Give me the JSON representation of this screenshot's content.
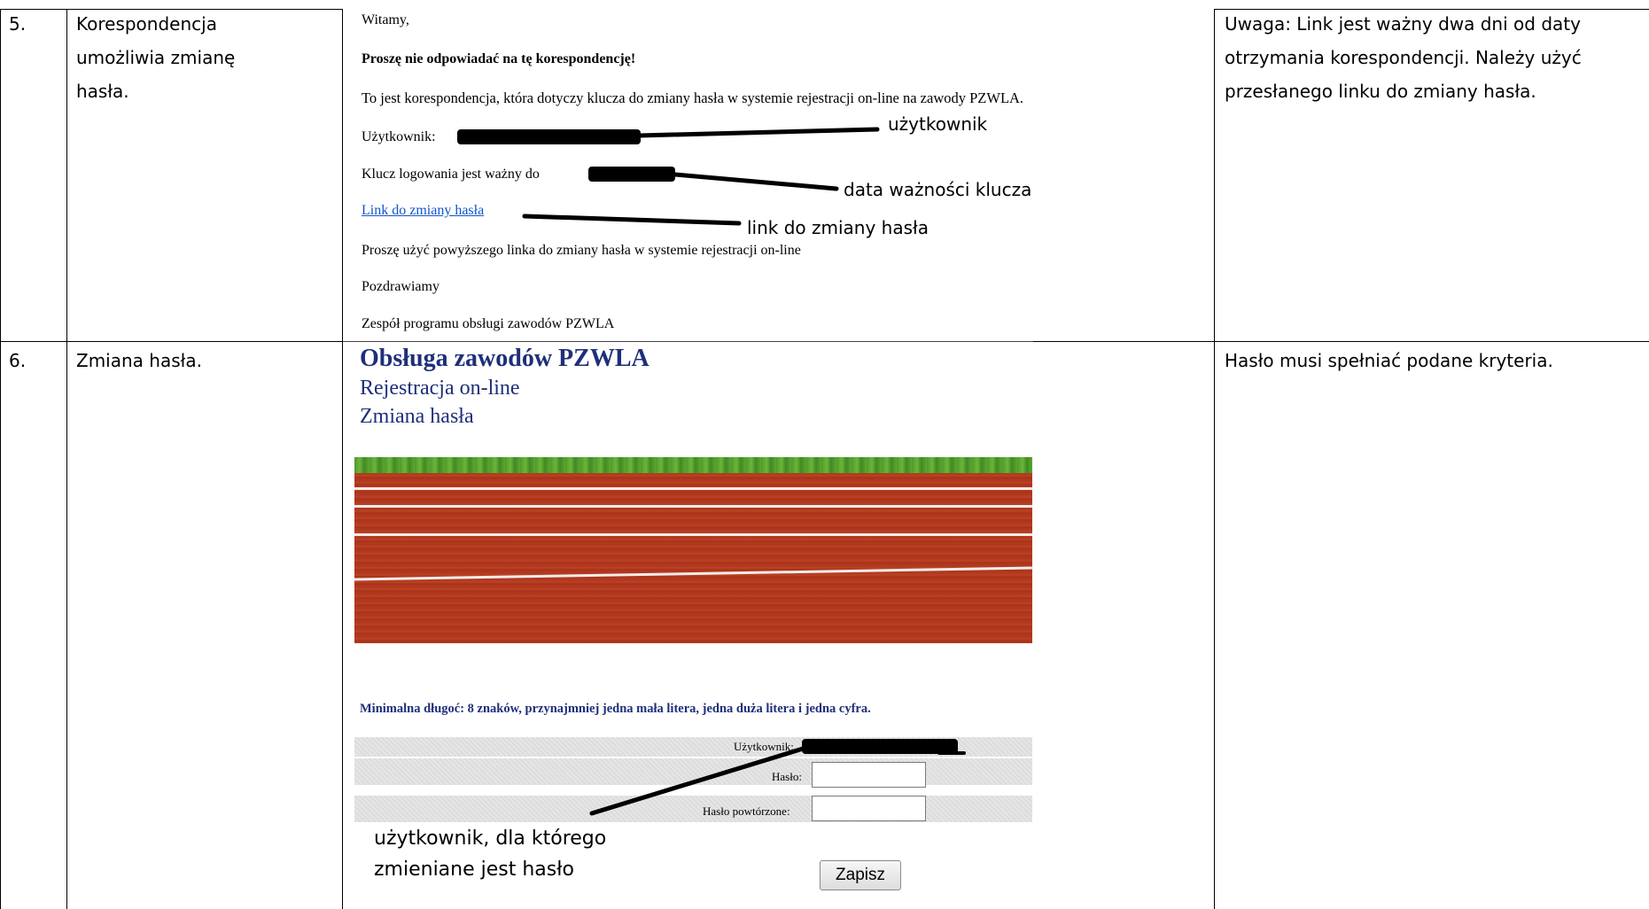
{
  "row5": {
    "number": "5.",
    "description": "Korespondencja umożliwia zmianę hasła.",
    "description_lines": [
      "Korespondencja",
      "umożliwia zmianę",
      "hasła."
    ],
    "note_lines": [
      "Uwaga: Link jest ważny dwa dni od daty",
      "otrzymania korespondencji. Należy użyć",
      "przesłanego linku do zmiany hasła."
    ],
    "email": {
      "greeting": "Witamy,",
      "warning": "Proszę nie odpowiadać na tę korespondencję!",
      "intro": "To jest korespondencja, która dotyczy klucza do zmiany hasła w systemie rejestracji on-line na zawody PZWLA.",
      "user_label": "Użytkownik:",
      "key_valid_label": "Klucz logowania jest ważny do",
      "link_text": "Link do zmiany hasła",
      "instruction": "Proszę użyć powyższego linka do zmiany hasła w systemie rejestracji on-line",
      "regards": "Pozdrawiamy",
      "signature": "Zespół programu obsługi zawodów PZWLA"
    },
    "annotations": {
      "user": "użytkownik",
      "expiry": "data ważności klucza",
      "link": "link do zmiany hasła"
    }
  },
  "row6": {
    "number": "6.",
    "description": "Zmiana hasła.",
    "note": "Hasło musi spełniać podane kryteria.",
    "page": {
      "title": "Obsługa zawodów PZWLA",
      "subtitle1": "Rejestracja on-line",
      "subtitle2": "Zmiana hasła",
      "criteria": "Minimalna długoć: 8 znaków, przynajmniej jedna mała litera, jedna duża litera i jedna cyfra.",
      "user_label": "Użytkownik:",
      "password_label": "Hasło:",
      "password_repeat_label": "Hasło powtórzone:",
      "password_value": "",
      "password_repeat_value": "",
      "save_button": "Zapisz"
    },
    "annotation_lines": [
      "użytkownik, dla którego",
      "zmieniane jest hasło"
    ]
  },
  "colors": {
    "heading_blue": "#1f2f7a",
    "link_blue": "#1155cc",
    "track_red": "#b33a22",
    "grass_green": "#5aa832",
    "form_gray": "#dcdcdc"
  }
}
